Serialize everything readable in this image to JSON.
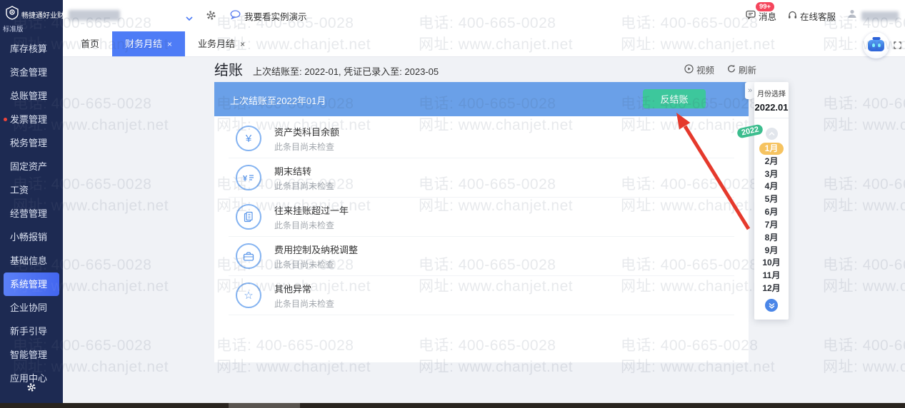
{
  "brand": {
    "name": "畅捷通好业财",
    "edition": "标准版"
  },
  "topbar": {
    "demo": "我要看实例演示",
    "messages": "消息",
    "messages_badge": "99+",
    "support": "在线客服"
  },
  "tabs": {
    "home": "首页",
    "finance": "财务月结",
    "business": "业务月结",
    "close": "×"
  },
  "sidebar": {
    "items": [
      {
        "label": "库存核算"
      },
      {
        "label": "资金管理"
      },
      {
        "label": "总账管理"
      },
      {
        "label": "发票管理",
        "badge": true
      },
      {
        "label": "税务管理"
      },
      {
        "label": "固定资产"
      },
      {
        "label": "工资"
      },
      {
        "label": "经营管理"
      },
      {
        "label": "小畅报销"
      },
      {
        "label": "基础信息"
      },
      {
        "label": "系统管理",
        "active": true
      },
      {
        "label": "企业协同"
      },
      {
        "label": "新手引导"
      },
      {
        "label": "智能管理"
      },
      {
        "label": "应用中心"
      }
    ]
  },
  "page": {
    "title": "结账",
    "subtitle": "上次结账至: 2022-01, 凭证已录入至: 2023-05",
    "video": "视频",
    "refresh": "刷新"
  },
  "banner": {
    "text": "上次结账至2022年01月",
    "button": "反结账"
  },
  "checklist": [
    {
      "title": "资产类科目余额",
      "status": "此条目尚未检查",
      "icon": "yen-circle-icon"
    },
    {
      "title": "期末结转",
      "status": "此条目尚未检查",
      "icon": "period-end-transfer-icon"
    },
    {
      "title": "往来挂账超过一年",
      "status": "此条目尚未检查",
      "icon": "document-icon"
    },
    {
      "title": "费用控制及纳税调整",
      "status": "此条目尚未检查",
      "icon": "briefcase-icon"
    },
    {
      "title": "其他异常",
      "status": "此条目尚未检查",
      "icon": "star-icon"
    }
  ],
  "month_panel": {
    "collapse": "»",
    "title": "月份选择",
    "current": "2022.01",
    "year_badge": "2022",
    "selected_month": "1月",
    "months": [
      "1月",
      "2月",
      "3月",
      "4月",
      "5月",
      "6月",
      "7月",
      "8月",
      "9月",
      "10月",
      "11月",
      "12月"
    ]
  },
  "watermark": {
    "line1": "电话: 400-665-0028",
    "line2": "网址: www.chanjet.net"
  },
  "colors": {
    "accent": "#4e7cf6",
    "banner_blue": "#6aa0e8",
    "button_green": "#3dc79c",
    "sidebar_navy": "#1d2a52",
    "month_selected": "#f6c360",
    "badge_red": "#f5455c",
    "year_badge_green": "#3cbd8e",
    "arrow_red": "#e5392c",
    "icon_blue": "#5a96ea"
  }
}
